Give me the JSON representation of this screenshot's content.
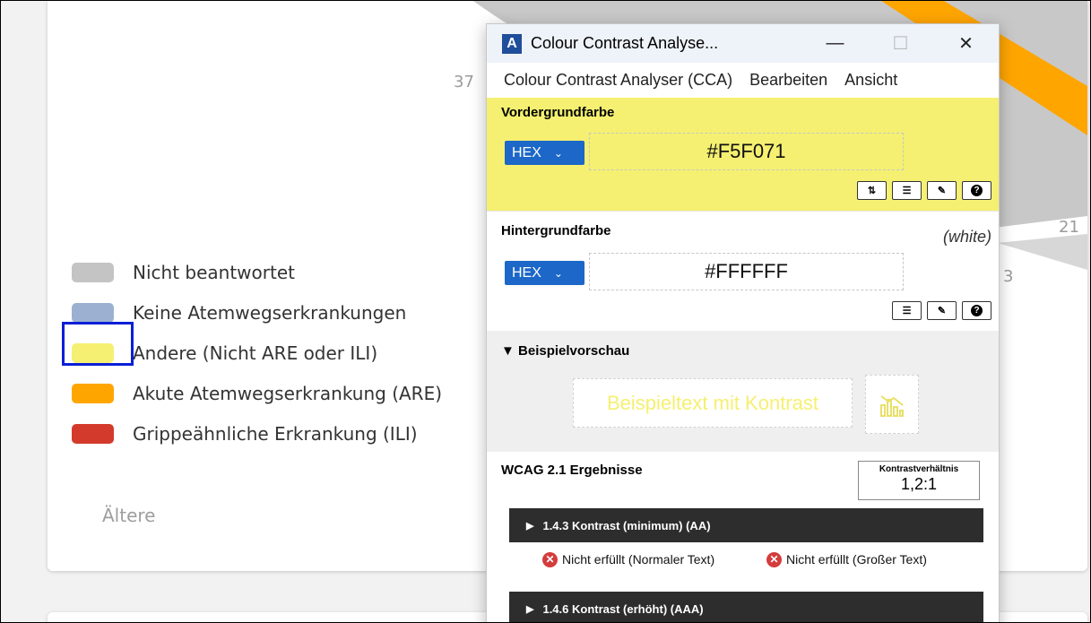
{
  "background": {
    "axis_labels": [
      "37",
      "21",
      "3"
    ],
    "legend": [
      {
        "label": "Nicht beantwortet",
        "color": "#c4c4c4"
      },
      {
        "label": "Keine Atemwegserkrankungen",
        "color": "#9cb1d1"
      },
      {
        "label": "Andere (Nicht ARE oder ILI)",
        "color": "#f5f071"
      },
      {
        "label": "Akute Atemwegserkrankung (ARE)",
        "color": "#ffa500"
      },
      {
        "label": "Grippeähnliche Erkrankung (ILI)",
        "color": "#d33a2b"
      }
    ],
    "older_label": "Ältere"
  },
  "cca": {
    "title": "Colour Contrast Analyse...",
    "window_buttons": {
      "minimize": "—",
      "maximize": "☐",
      "close": "✕"
    },
    "menu": [
      "Colour Contrast Analyser (CCA)",
      "Bearbeiten",
      "Ansicht"
    ],
    "foreground": {
      "title": "Vordergrundfarbe",
      "format": "HEX",
      "value": "#F5F071",
      "color": "#f5f071"
    },
    "background": {
      "title": "Hintergrundfarbe",
      "note": "(white)",
      "format": "HEX",
      "value": "#FFFFFF"
    },
    "preview": {
      "title": "▼ Beispielvorschau",
      "sample_text": "Beispieltext mit Kontrast"
    },
    "results": {
      "title": "WCAG 2.1 Ergebnisse",
      "ratio_label": "Kontrastverhältnis",
      "ratio_value": "1,2:1",
      "criteria": [
        {
          "label": "1.4.3 Kontrast (minimum) (AA)"
        },
        {
          "label": "1.4.6 Kontrast (erhöht) (AAA)"
        }
      ],
      "normal_text": "Nicht erfüllt (Normaler Text)",
      "large_text": "Nicht erfüllt (Großer Text)"
    }
  }
}
